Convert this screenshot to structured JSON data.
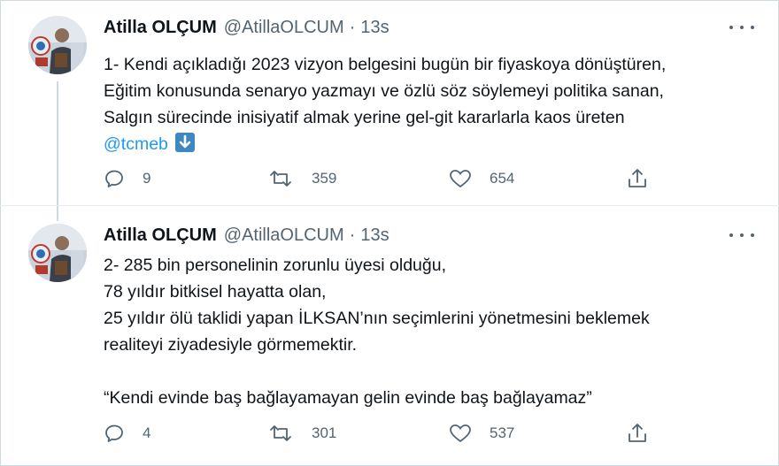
{
  "tweets": [
    {
      "author_name": "Atilla OLÇUM",
      "handle": "@AtillaOLCUM",
      "separator": "·",
      "time": "13s",
      "lines": [
        "1- Kendi açıkladığı 2023 vizyon belgesini bugün bir fiyaskoya dönüştüren,",
        "Eğitim konusunda senaryo yazmayı ve özlü söz söylemeyi politika sanan,",
        "Salgın sürecinde inisiyatif almak yerine gel-git kararlarla kaos üreten"
      ],
      "mention": "@tcmeb",
      "emoji": "down-arrow-emoji",
      "replies": "9",
      "retweets": "359",
      "likes": "654"
    },
    {
      "author_name": "Atilla OLÇUM",
      "handle": "@AtillaOLCUM",
      "separator": "·",
      "time": "13s",
      "lines": [
        "2- 285 bin personelinin zorunlu üyesi olduğu,",
        "78 yıldır bitkisel hayatta olan,",
        "25 yıldır ölü taklidi yapan İLKSAN’nın seçimlerini yönetmesini beklemek",
        "realiteyi ziyadesiyle görmemektir."
      ],
      "quote": "“Kendi evinde baş bağlayamayan gelin evinde baş bağlayamaz”",
      "replies": "4",
      "retweets": "301",
      "likes": "537"
    }
  ],
  "icons": [
    "more-icon",
    "reply-icon",
    "retweet-icon",
    "like-icon",
    "share-icon",
    "avatar"
  ],
  "colors": {
    "text": "#0f1419",
    "secondary": "#536471",
    "link": "#1d9bf0",
    "border": "#cfd9de"
  }
}
